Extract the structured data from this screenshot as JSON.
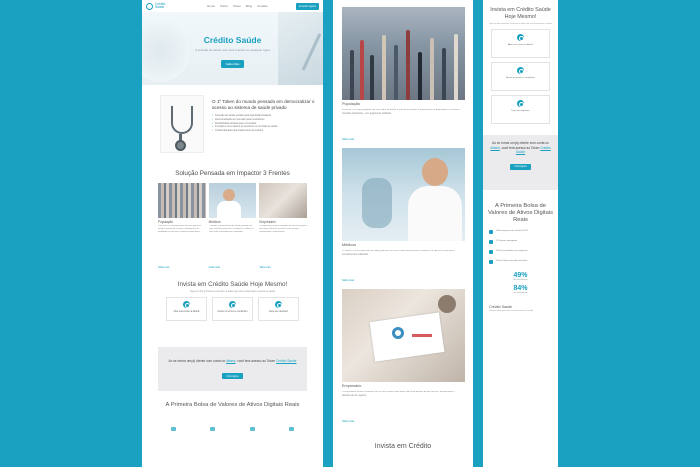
{
  "panel1": {
    "logo_text": "Crédito Saúde",
    "nav": [
      "Home",
      "Sobre",
      "Token",
      "Blog",
      "Contato"
    ],
    "nav_cta": "Investir Agora",
    "hero_title": "Crédito Saúde",
    "hero_sub": "A solução de saúde que você precisa em qualquer lugar",
    "hero_button": "Saiba Mais",
    "token_heading": "O 1º Token do mundo pensado em democratizar o acesso ao sistema de saúde privado",
    "token_bullets": [
      "Conexão de saúde privada para população brasileira",
      "Democratização do mercado para investidores",
      "Rentabilidade atrativa para o investidor",
      "Inovações como tokens de benefício no mercado de saúde",
      "Crédito liberado para tratamentos via sistema"
    ],
    "section_title": "Solução Pensada em Impactor 3 Frentes",
    "cards": [
      {
        "label": "População",
        "text": "Cerca de 75% da população não tem plano de saúde e precisa de acesso a tratamentos de qualidade em clínicas e hospitais particulares.",
        "more": "Saiba mais"
      },
      {
        "label": "Médicos",
        "text": "O médico e profissionais de saúde ganham um novo canal de pacientes e recebem os valores à vista pelos procedimentos realizados.",
        "more": "Saiba mais"
      },
      {
        "label": "Empresário",
        "text": "O empresário recebe a liquidez de um novo público que antes não tinha acesso ao seu serviço, aumentando o faturamento.",
        "more": "Saiba mais"
      }
    ],
    "invest_title": "Invista em Crédito Saúde Hoje Mesmo!",
    "invest_sub": "Seja um dos primeiros a investir no token que vai revolucionar o acesso à saúde",
    "steps": [
      "Abra sua conta na dibank",
      "Aceite os termos e condições",
      "Faça seu depósito"
    ],
    "cta_text_pre": "Ao se tornar um(a) cliente com conta no",
    "cta_bank": "dibank",
    "cta_text_mid": ", você terá acesso ao Token",
    "cta_token": "Crédito Saúde",
    "cta_button": "Criar Agora",
    "bolsa_title": "A Primeira Bolsa de Valores de Ativos Digitais Reais"
  },
  "panel2": {
    "items": [
      {
        "label": "População",
        "text": "Cerca de 75% da população não tem plano de saúde e precisa de acesso a tratamentos de qualidade em clínicas e hospitais particulares, com pagamento facilitado.",
        "more": "Saiba mais"
      },
      {
        "label": "Médicos",
        "text": "O médico e os profissionais de saúde ganham um novo canal de pacientes e recebem os valores à vista pelos procedimentos realizados.",
        "more": "Saiba mais"
      },
      {
        "label": "Empresário",
        "text": "O empresário recebe a liquidez de um novo público que antes não tinha acesso ao seu serviço, aumentando o faturamento do negócio.",
        "more": "Saiba mais"
      }
    ],
    "footer_title": "Invista em Crédito"
  },
  "panel3": {
    "invest_title": "Invista em Crédito Saúde Hoje Mesmo!",
    "invest_sub": "Seja um dos primeiros a investir no token que vai revolucionar a saúde",
    "steps": [
      "Abra sua conta na dibank",
      "Aceite os termos e condições",
      "Faça seu depósito"
    ],
    "cta_text_pre": "Ao se tornar um(a) cliente com conta no",
    "cta_bank": "dibank",
    "cta_text_mid": ", você terá acesso ao Token",
    "cta_token": "Crédito Saúde",
    "cta_button": "Criar Agora",
    "bolsa_title": "A Primeira Bolsa de Valores de Ativos Digitais Reais",
    "stats": [
      "1000 empresas até o final de 2027",
      "170 países abrangidos",
      "200 mil investidores em empresas",
      "200 mil tokens lançados em bolsa"
    ],
    "big1_value": "49%",
    "big1_label": "dos investidores",
    "big2_value": "84%",
    "big2_label": "de rentabilidade",
    "footer_title": "Crédito Saúde",
    "footer_sub": "Primeiro token pensado em democratizar a saúde"
  }
}
